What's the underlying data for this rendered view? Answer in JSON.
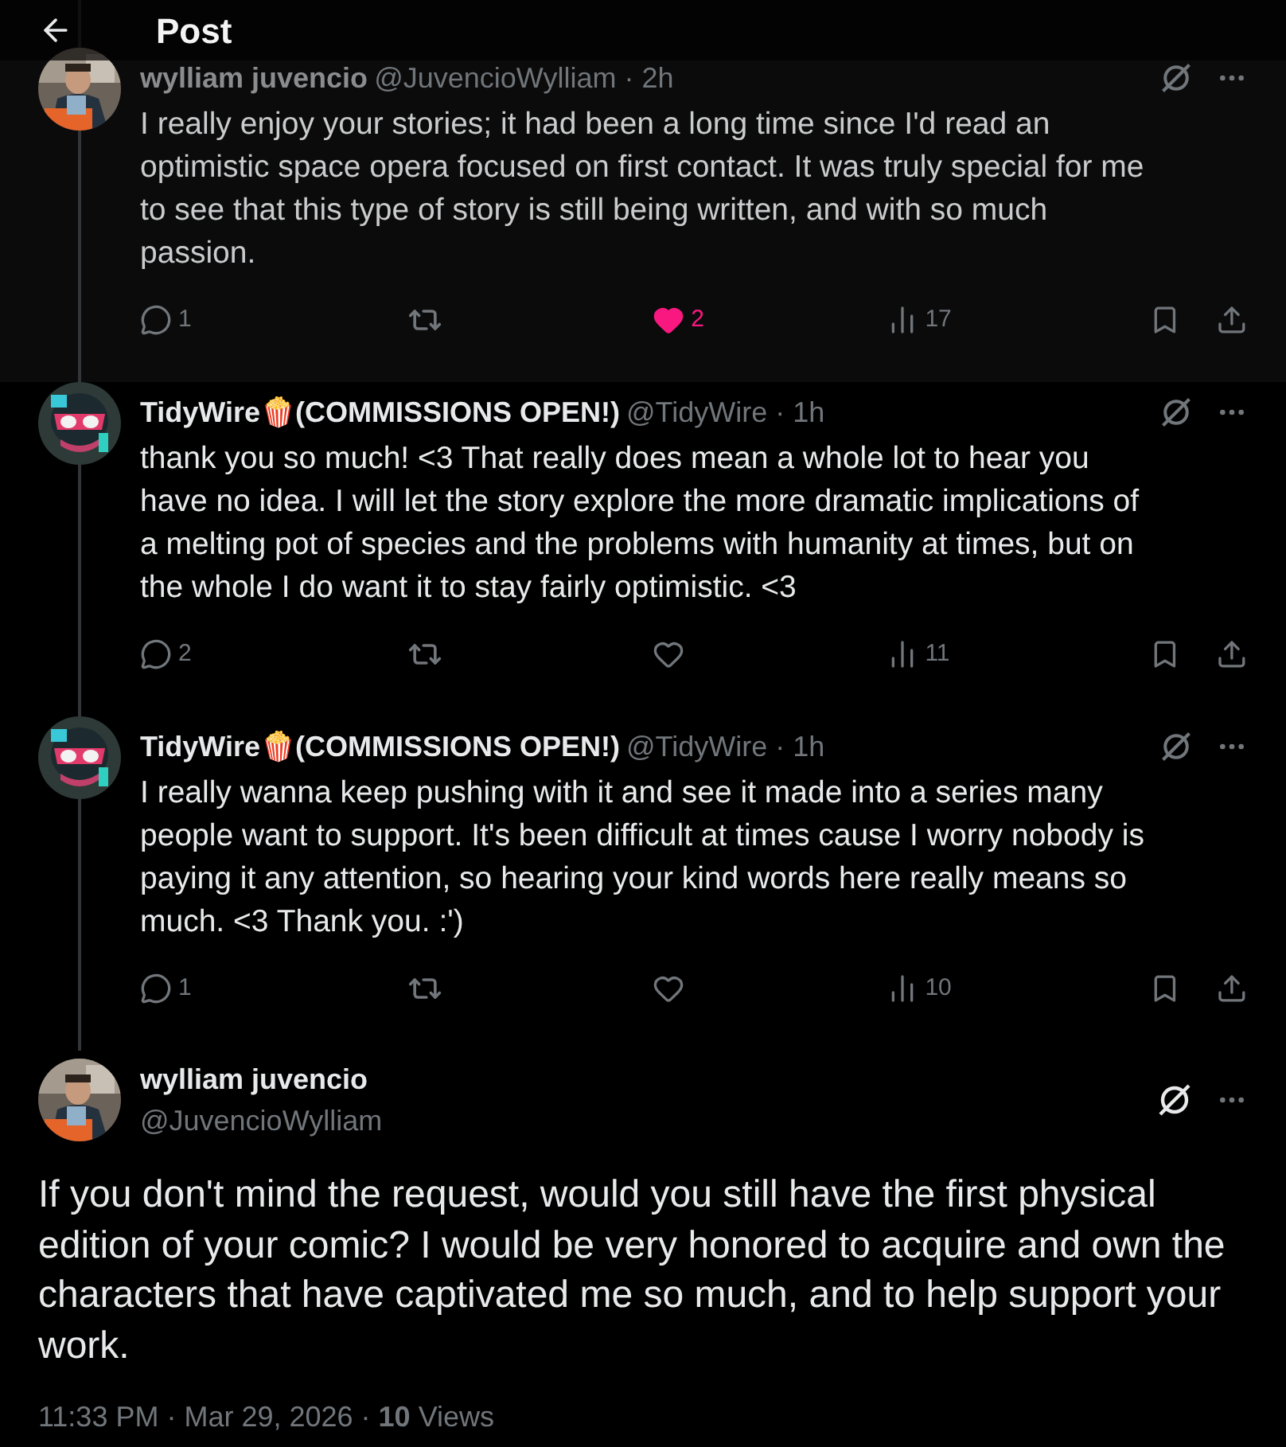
{
  "header": {
    "title": "Post"
  },
  "replies": [
    {
      "name": "wylliam juvencio",
      "meta": "@JuvencioWylliam · 2h",
      "dimmed": true,
      "text": "I really enjoy your stories; it had been a long time since I'd read an optimistic space opera focused on first contact. It was truly special for me to see that this type of story is still being written, and with so much passion.",
      "replies": "1",
      "likes": "2",
      "liked": true,
      "views": "17"
    },
    {
      "name": "TidyWire🍿(COMMISSIONS OPEN!)",
      "meta": "@TidyWire · 1h",
      "dimmed": false,
      "avatar": {
        "kind": "drawing"
      },
      "text": "thank you so much! <3 That really does mean a whole lot to hear you have no idea. I will let the story explore the more dramatic implications of a melting pot of species and the problems with humanity at times, but on the whole I do want it to stay fairly optimistic. <3",
      "replies": "2",
      "liked": false,
      "views": "11"
    },
    {
      "name": "TidyWire🍿(COMMISSIONS OPEN!)",
      "meta": "@TidyWire · 1h",
      "dimmed": false,
      "avatar": {
        "kind": "drawing"
      },
      "text": "I really wanna keep pushing with it and see it made into a series many people want to support. It's been difficult at times cause I worry nobody is paying it any attention, so hearing your kind words here really means so much. <3 Thank you. :')",
      "replies": "1",
      "liked": false,
      "views": "10"
    }
  ],
  "main_post": {
    "name": "wylliam juvencio",
    "handle": "@JuvencioWylliam",
    "text": "If you don't mind the request, would you still have the first physical edition of your comic? I would be very honored to acquire and own the characters that have captivated me so much, and to help support your work.",
    "footer": "11:33 PM · Mar 29, 2026 · **10** Views"
  }
}
